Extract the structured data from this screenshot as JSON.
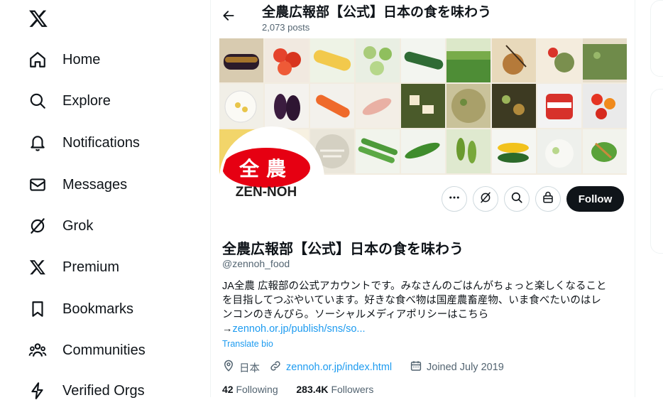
{
  "nav": {
    "items": [
      {
        "label": "Home"
      },
      {
        "label": "Explore"
      },
      {
        "label": "Notifications"
      },
      {
        "label": "Messages"
      },
      {
        "label": "Grok"
      },
      {
        "label": "Premium"
      },
      {
        "label": "Bookmarks"
      },
      {
        "label": "Communities"
      },
      {
        "label": "Verified Orgs"
      }
    ]
  },
  "header": {
    "name": "全農広報部【公式】日本の食を味わう",
    "posts": "2,073 posts"
  },
  "avatar": {
    "logo_chars": "全農",
    "logo_text": "ZEN-NOH"
  },
  "actions": {
    "follow_label": "Follow"
  },
  "profile": {
    "name": "全農広報部【公式】日本の食を味わう",
    "handle": "@zennoh_food",
    "bio_lines": [
      "JA全農 広報部の公式アカウントです。みなさんのごはんがちょっと楽しくなること",
      "を目指してつぶやいています。好きな食べ物は国産農畜産物、いま食べたいのはレ",
      "ンコンのきんぴら。ソーシャルメディアポリシーはこちら"
    ],
    "bio_arrow": "→",
    "bio_link": "zennoh.or.jp/publish/sns/so...",
    "translate_label": "Translate bio",
    "location": "日本",
    "website": "zennoh.or.jp/index.html",
    "joined": "Joined July 2019",
    "following_count": "42",
    "following_label": "Following",
    "followers_count": "283.4K",
    "followers_label": "Followers"
  },
  "colors": {
    "accent": "#1d9bf0",
    "text": "#0f1419",
    "muted": "#536471",
    "logo_red": "#e60012"
  }
}
